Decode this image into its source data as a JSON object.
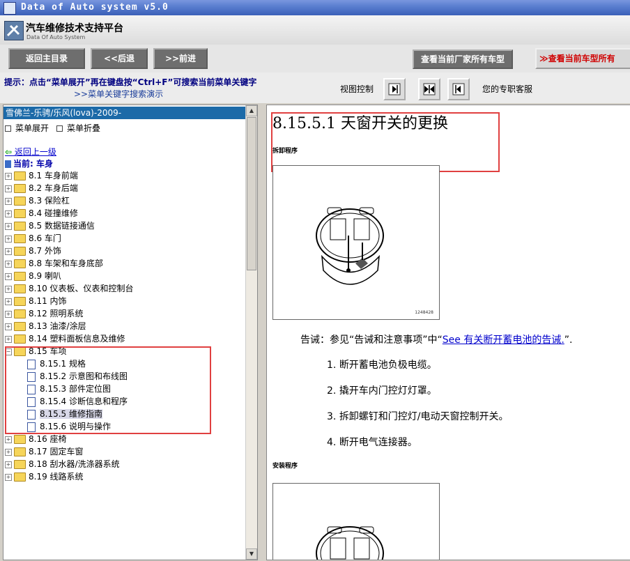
{
  "window": {
    "title": "Data of Auto system v5.0"
  },
  "app": {
    "name": "汽车维修技术支持平台",
    "subtitle": "Data Of Auto System"
  },
  "toolbar": {
    "home_label": "返回主目录",
    "back_label": "<<后退",
    "forward_label": ">>前进",
    "maker_models_label": "查看当前厂家所有车型",
    "current_model_label": "≫查看当前车型所有"
  },
  "hint": {
    "text": "提示：点击“菜单展开”再在键盘按“Ctrl+F”可搜索当前菜单关键字",
    "demo_link": ">>菜单关键字搜索演示",
    "view_control_label": "视图控制",
    "service_label": "您的专职客服"
  },
  "tree": {
    "breadcrumb": "雪佛兰-乐骋/乐风(lova)-2009-",
    "expand_label": "菜单展开",
    "collapse_label": "菜单折叠",
    "back_link": "返回上一级",
    "current_label": "当前: 车身",
    "items": [
      {
        "label": "8.1 车身前端"
      },
      {
        "label": "8.2 车身后端"
      },
      {
        "label": "8.3 保险杠"
      },
      {
        "label": "8.4 碰撞维修"
      },
      {
        "label": "8.5 数据链接通信"
      },
      {
        "label": "8.6 车门"
      },
      {
        "label": "8.7 外饰"
      },
      {
        "label": "8.8 车架和车身底部"
      },
      {
        "label": "8.9 喇叭"
      },
      {
        "label": "8.10 仪表板、仪表和控制台"
      },
      {
        "label": "8.11 内饰"
      },
      {
        "label": "8.12 照明系统"
      },
      {
        "label": "8.13 油漆/涂层"
      },
      {
        "label": "8.14 塑料面板信息及维修"
      },
      {
        "label": "8.15 车项"
      },
      {
        "label": "8.15.1 规格"
      },
      {
        "label": "8.15.2 示意图和布线图"
      },
      {
        "label": "8.15.3 部件定位图"
      },
      {
        "label": "8.15.4 诊断信息和程序"
      },
      {
        "label": "8.15.5 维修指南"
      },
      {
        "label": "8.15.6 说明与操作"
      },
      {
        "label": "8.16 座椅"
      },
      {
        "label": "8.17 固定车窗"
      },
      {
        "label": "8.18 刮水器/洗涤器系统"
      },
      {
        "label": "8.19 线路系统"
      }
    ]
  },
  "content": {
    "title": "8.15.5.1 天窗开关的更换",
    "removal_heading": "拆卸程序",
    "figure1_number": "1248428",
    "warning_prefix": "告诫：参见“告诫和注意事项”中“",
    "warning_link": "See 有关断开蓄电池的告诫.",
    "warning_suffix": "”.",
    "steps": [
      {
        "num": "1.",
        "text": "断开蓄电池负极电缆。"
      },
      {
        "num": "2.",
        "text": "撬开车内门控灯灯罩。"
      },
      {
        "num": "3.",
        "text": "拆卸螺钉和门控灯/电动天窗控制开关。"
      },
      {
        "num": "4.",
        "text": "断开电气连接器。"
      }
    ],
    "install_heading": "安装程序"
  }
}
